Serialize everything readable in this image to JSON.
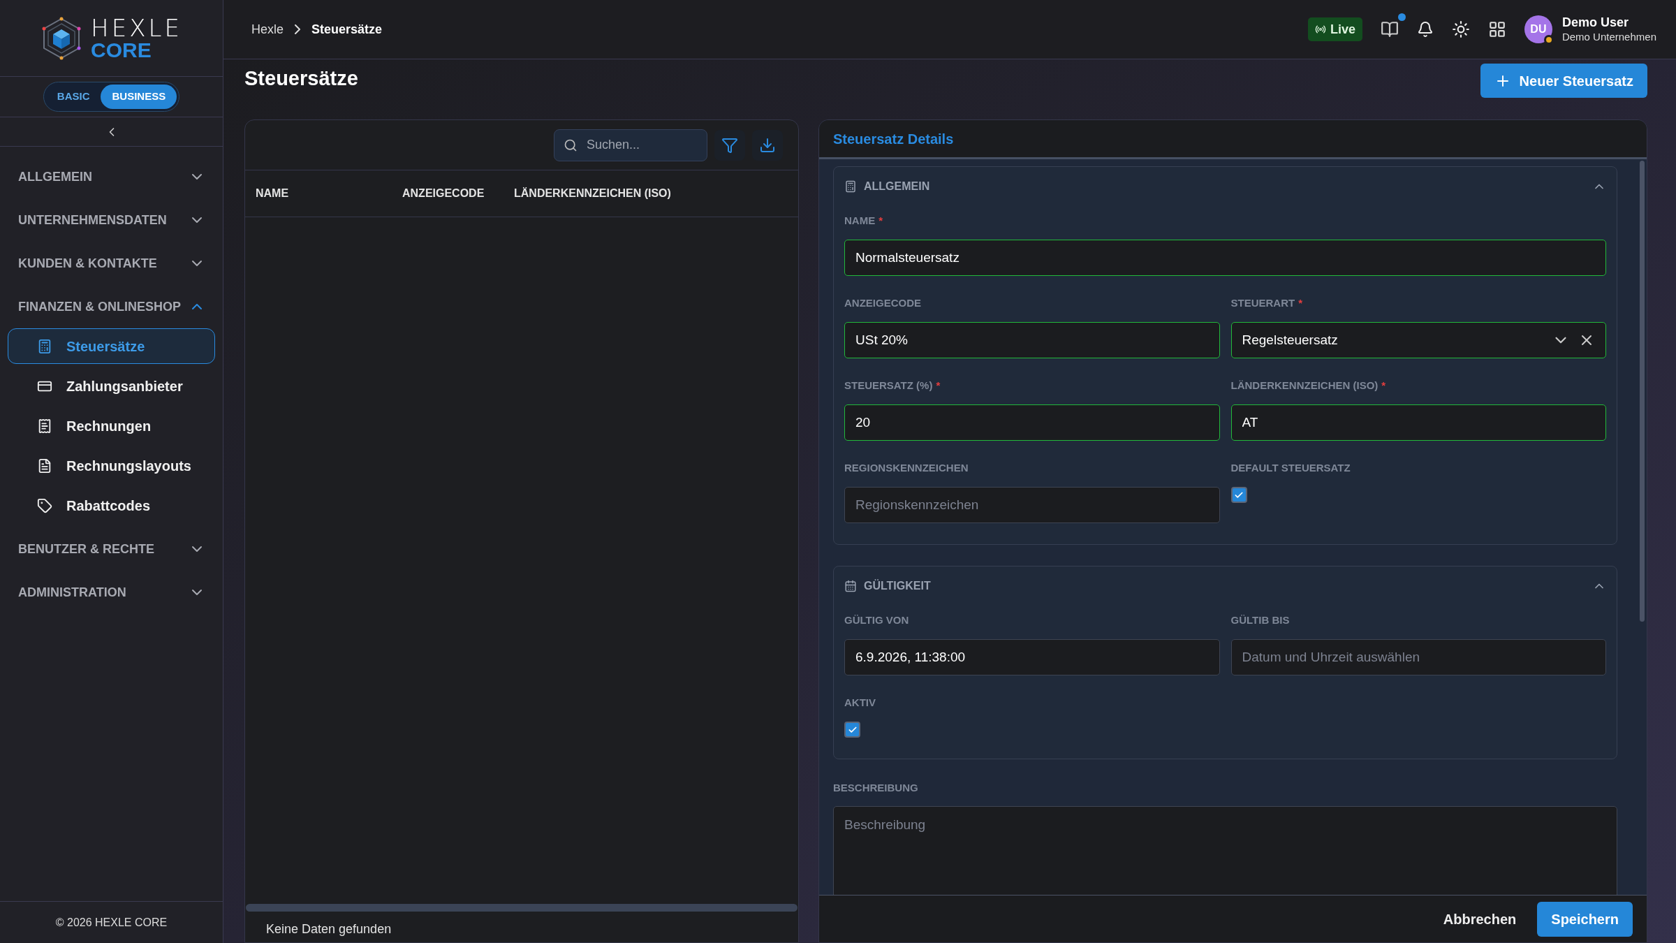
{
  "logo": {
    "line1": "HEXLE",
    "line2": "CORE"
  },
  "plan_toggle": [
    {
      "label": "BASIC",
      "selected": false
    },
    {
      "label": "BUSINESS",
      "selected": true
    }
  ],
  "sidebar": {
    "sections": [
      {
        "label": "ALLGEMEIN",
        "expanded": false
      },
      {
        "label": "UNTERNEHMENSDATEN",
        "expanded": false
      },
      {
        "label": "KUNDEN & KONTAKTE",
        "expanded": false
      },
      {
        "label": "FINANZEN & ONLINESHOP",
        "expanded": true,
        "children": [
          {
            "label": "Steuersätze",
            "selected": true
          },
          {
            "label": "Zahlungsanbieter",
            "selected": false
          },
          {
            "label": "Rechnungen",
            "selected": false
          },
          {
            "label": "Rechnungslayouts",
            "selected": false
          },
          {
            "label": "Rabattcodes",
            "selected": false
          }
        ]
      },
      {
        "label": "BENUTZER & RECHTE",
        "expanded": false
      },
      {
        "label": "ADMINISTRATION",
        "expanded": false
      }
    ],
    "footer": "© 2026 HEXLE CORE"
  },
  "header": {
    "breadcrumb": [
      "Hexle",
      "Steuersätze"
    ],
    "live": "Live",
    "docs_unread": true,
    "user": {
      "initials": "DU",
      "name": "Demo User",
      "company": "Demo Unternehmen"
    }
  },
  "page": {
    "title": "Steuersätze",
    "new_button": "Neuer Steuersatz"
  },
  "table": {
    "search": {
      "placeholder": "Suchen..."
    },
    "columns": [
      "NAME",
      "ANZEIGECODE",
      "LÄNDERKENNZEICHEN (ISO)"
    ],
    "empty": "Keine Daten gefunden"
  },
  "details": {
    "title": "Steuersatz Details",
    "sections": [
      {
        "title": "ALLGEMEIN",
        "expanded": true,
        "rows": [
          [
            {
              "kind": "text",
              "label": "NAME",
              "required": "*",
              "value": "Normalsteuersatz",
              "valid": true
            }
          ],
          [
            {
              "kind": "text",
              "label": "ANZEIGECODE",
              "value": "USt 20%",
              "valid": true
            },
            {
              "kind": "select",
              "label": "STEUERART",
              "required": "*",
              "value": "Regelsteuersatz",
              "valid": true
            }
          ],
          [
            {
              "kind": "text",
              "label": "STEUERSATZ (%)",
              "required": "*",
              "value": "20",
              "valid": true
            },
            {
              "kind": "text",
              "label": "LÄNDERKENNZEICHEN (ISO)",
              "required": "*",
              "value": "AT",
              "valid": true
            }
          ],
          [
            {
              "kind": "text",
              "label": "REGIONSKENNZEICHEN",
              "placeholder": "Regionskennzeichen",
              "valid": false
            },
            {
              "kind": "checkbox",
              "label": "DEFAULT STEUERSATZ",
              "checked": true
            }
          ]
        ]
      },
      {
        "title": "GÜLTIGKEIT",
        "expanded": true,
        "rows": [
          [
            {
              "kind": "text",
              "label": "GÜLTIG VON",
              "value": "6.9.2026, 11:38:00",
              "valid": false
            },
            {
              "kind": "text",
              "label": "GÜLTIB BIS",
              "placeholder": "Datum und Uhrzeit auswählen",
              "valid": false
            }
          ],
          [
            {
              "kind": "checkbox",
              "label": "AKTIV",
              "checked": true
            }
          ]
        ]
      }
    ],
    "description": {
      "label": "BESCHREIBUNG",
      "placeholder": "Beschreibung"
    },
    "cancel": "Abbrechen",
    "save": "Speichern"
  }
}
